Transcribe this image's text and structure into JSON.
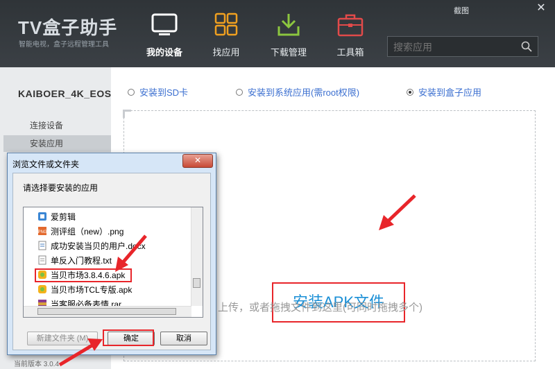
{
  "app": {
    "brand": "TV盒子助手",
    "brand_sub": "智能电视，盒子远程管理工具",
    "screenshot_label": "截图",
    "close_label": "✕"
  },
  "nav": [
    {
      "label": "我的设备",
      "icon": "tv-icon"
    },
    {
      "label": "找应用",
      "icon": "apps-grid-icon"
    },
    {
      "label": "下载管理",
      "icon": "download-icon"
    },
    {
      "label": "工具箱",
      "icon": "toolbox-icon"
    }
  ],
  "search": {
    "placeholder": "搜索应用"
  },
  "sidebar": {
    "device": "KAIBOER_4K_EOS",
    "items": [
      {
        "label": "连接设备"
      },
      {
        "label": "安装应用",
        "selected": true
      }
    ],
    "version": "当前版本 3.0.4"
  },
  "install_options": [
    {
      "label": "安装到SD卡",
      "checked": false
    },
    {
      "label": "安装到系统应用(需root权限)",
      "checked": false
    },
    {
      "label": "安装到盒子应用",
      "checked": true
    }
  ],
  "main": {
    "install_button": "安装APK文件",
    "drop_hint": "上传，或者拖拽文件到这里(可同时拖拽多个)"
  },
  "dialog": {
    "title": "浏览文件或文件夹",
    "close": "✕",
    "prompt": "请选择要安装的应用",
    "files": [
      {
        "name": "爱剪辑",
        "icon": "app-icon"
      },
      {
        "name": "测评组（new）.png",
        "icon": "png-icon"
      },
      {
        "name": "成功安装当贝的用户.docx",
        "icon": "doc-icon"
      },
      {
        "name": "单反入门教程.txt",
        "icon": "txt-icon"
      },
      {
        "name": "当贝市场3.8.4.6.apk",
        "icon": "apk-icon",
        "selected": true
      },
      {
        "name": "当贝市场TCL专版.apk",
        "icon": "apk-icon"
      },
      {
        "name": "当客服必备表情.rar",
        "icon": "rar-icon"
      }
    ],
    "new_folder": "新建文件夹 (M)",
    "ok": "确定",
    "cancel": "取消"
  },
  "colors": {
    "accent": "#1a8fd6",
    "highlight": "#e8252a",
    "topbar": "#33383c"
  }
}
